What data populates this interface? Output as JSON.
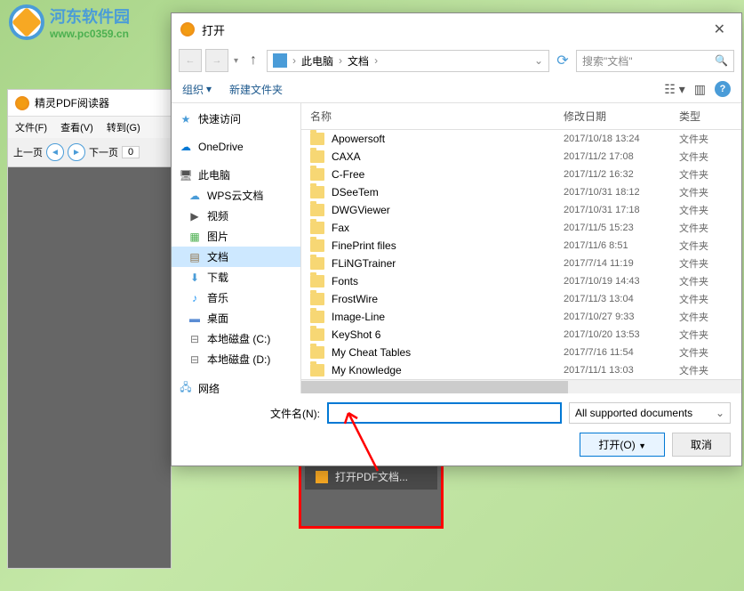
{
  "logo": {
    "title": "河东软件园",
    "url": "www.pc0359.cn"
  },
  "bg_app": {
    "title": "精灵PDF阅读器",
    "menu": {
      "file": "文件(F)",
      "view": "查看(V)",
      "goto": "转到(G)"
    },
    "toolbar": {
      "prev": "上一页",
      "next": "下一页",
      "page": "0"
    }
  },
  "popup": {
    "label": "打开PDF文档..."
  },
  "dialog": {
    "title": "打开",
    "breadcrumb": {
      "pc": "此电脑",
      "docs": "文档"
    },
    "search_placeholder": "搜索\"文档\"",
    "toolbar": {
      "organize": "组织",
      "newfolder": "新建文件夹"
    },
    "sidebar": {
      "quick": "快速访问",
      "onedrive": "OneDrive",
      "pc": "此电脑",
      "wps": "WPS云文档",
      "video": "视频",
      "pics": "图片",
      "docs": "文档",
      "down": "下载",
      "music": "音乐",
      "desktop": "桌面",
      "diskc": "本地磁盘 (C:)",
      "diskd": "本地磁盘 (D:)",
      "network": "网络"
    },
    "columns": {
      "name": "名称",
      "date": "修改日期",
      "type": "类型"
    },
    "files": [
      {
        "name": "Apowersoft",
        "date": "2017/10/18 13:24",
        "type": "文件夹"
      },
      {
        "name": "CAXA",
        "date": "2017/11/2 17:08",
        "type": "文件夹"
      },
      {
        "name": "C-Free",
        "date": "2017/11/2 16:32",
        "type": "文件夹"
      },
      {
        "name": "DSeeTem",
        "date": "2017/10/31 18:12",
        "type": "文件夹"
      },
      {
        "name": "DWGViewer",
        "date": "2017/10/31 17:18",
        "type": "文件夹"
      },
      {
        "name": "Fax",
        "date": "2017/11/5 15:23",
        "type": "文件夹"
      },
      {
        "name": "FinePrint files",
        "date": "2017/11/6 8:51",
        "type": "文件夹"
      },
      {
        "name": "FLiNGTrainer",
        "date": "2017/7/14 11:19",
        "type": "文件夹"
      },
      {
        "name": "Fonts",
        "date": "2017/10/19 14:43",
        "type": "文件夹"
      },
      {
        "name": "FrostWire",
        "date": "2017/11/3 13:04",
        "type": "文件夹"
      },
      {
        "name": "Image-Line",
        "date": "2017/10/27 9:33",
        "type": "文件夹"
      },
      {
        "name": "KeyShot 6",
        "date": "2017/10/20 13:53",
        "type": "文件夹"
      },
      {
        "name": "My Cheat Tables",
        "date": "2017/7/16 11:54",
        "type": "文件夹"
      },
      {
        "name": "My Knowledge",
        "date": "2017/11/1 13:03",
        "type": "文件夹"
      }
    ],
    "filename_label": "文件名(N):",
    "filetype": "All supported documents",
    "open_btn": "打开(O)",
    "cancel_btn": "取消"
  }
}
